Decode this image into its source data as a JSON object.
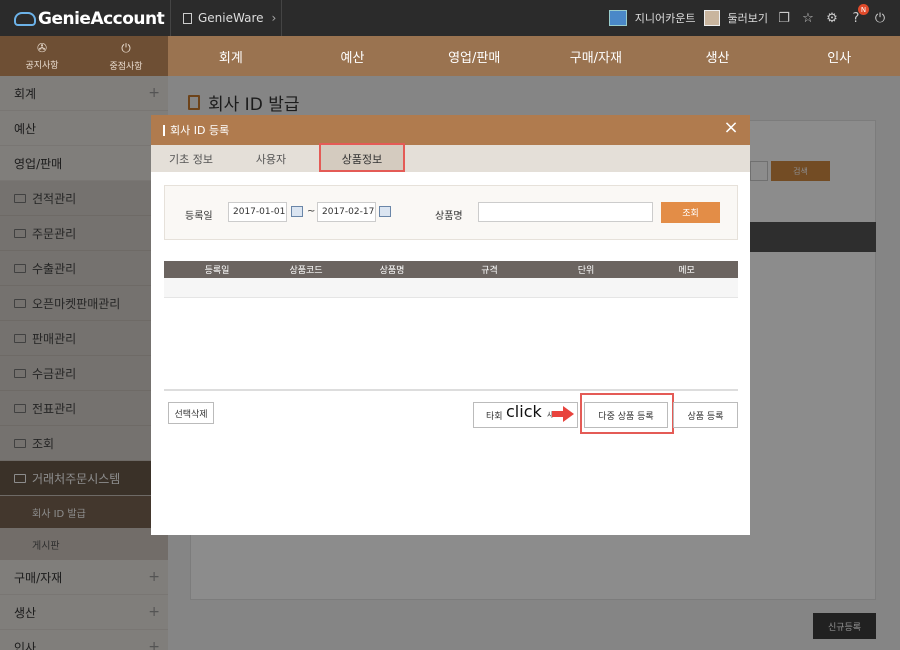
{
  "app": {
    "logo": "GenieAccount",
    "app_selector": "GenieWare",
    "account_label": "지니어카운트",
    "user_label": "둘러보기",
    "notification_badge": "N"
  },
  "quick": {
    "notice": "공지사항",
    "important": "중점사항"
  },
  "menu": [
    "회계",
    "예산",
    "영업/판매",
    "구매/자재",
    "생산",
    "인사"
  ],
  "sidebar": {
    "top": [
      "회계",
      "예산",
      "영업/판매"
    ],
    "sub": [
      "견적관리",
      "주문관리",
      "수출관리",
      "오픈마켓판매관리",
      "판매관리",
      "수금관리",
      "전표관리",
      "조회",
      "거래처주문시스템"
    ],
    "leaves": [
      "회사 ID 발급",
      "게시판"
    ],
    "bottom": [
      "구매/자재",
      "생산",
      "인사"
    ]
  },
  "page": {
    "title": "회사 ID 발급",
    "search_label": "검색",
    "new_reg": "신규등록"
  },
  "modal": {
    "title": "회사 ID 등록",
    "close": "×",
    "tabs": [
      "기초 정보",
      "사용자",
      "상품정보"
    ],
    "filter": {
      "date_label": "등록일",
      "date_from": "2017-01-01",
      "tilde": "~",
      "date_to": "2017-02-17",
      "product_label": "상품명",
      "query_btn": "조회"
    },
    "columns": [
      "등록일",
      "상품코드",
      "상품명",
      "규격",
      "단위",
      "메모"
    ],
    "buttons": {
      "delete": "선택삭제",
      "other": "타회",
      "other_suffix": "사",
      "multi": "다중 상품 등록",
      "register": "상품 등록"
    },
    "annotation": "click"
  },
  "colors": {
    "accent": "#b07b4e",
    "highlight": "#e45b56",
    "query": "#e38d47"
  }
}
